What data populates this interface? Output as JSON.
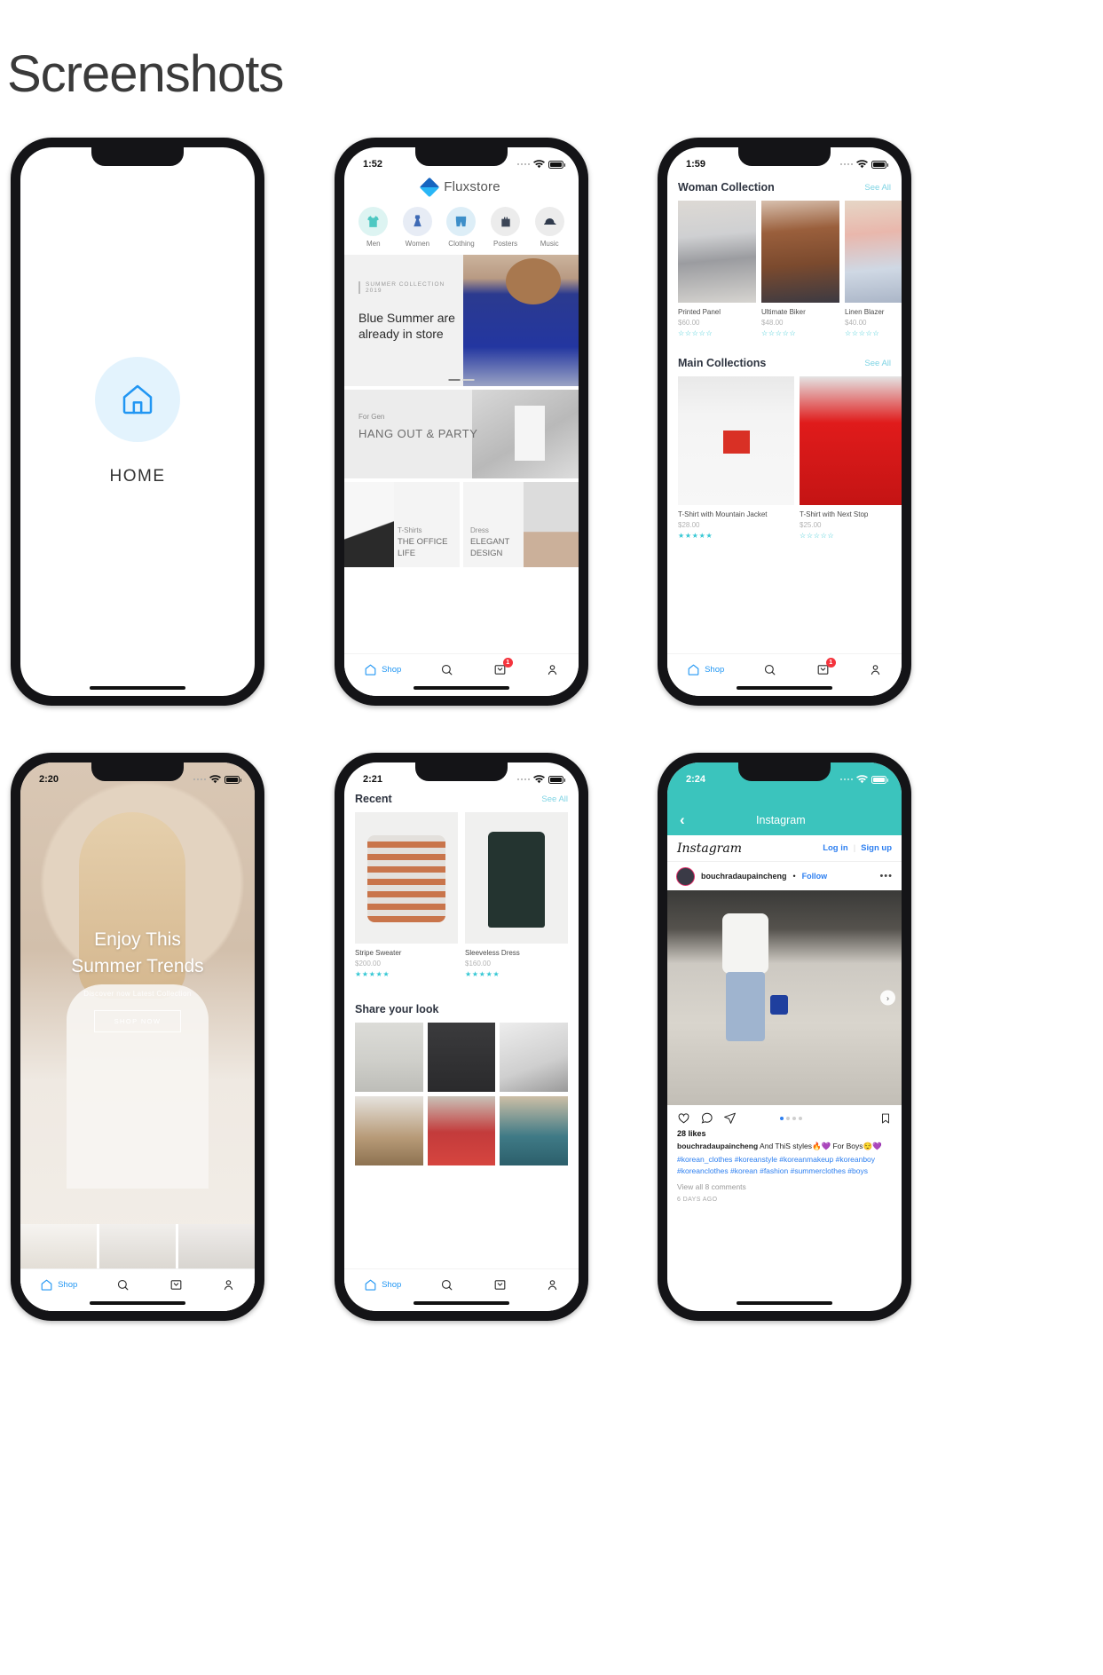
{
  "page": {
    "title": "Screenshots"
  },
  "phone1": {
    "splash": {
      "icon": "home-icon",
      "label": "HOME"
    }
  },
  "phone2": {
    "status": {
      "time": "1:52",
      "wifi": "wifi-icon",
      "battery": "battery-icon"
    },
    "brand": "Fluxstore",
    "categories": [
      {
        "label": "Men",
        "icon": "tshirt-icon",
        "bg": "#ddf4f2",
        "glyph": "👕"
      },
      {
        "label": "Women",
        "icon": "dress-icon",
        "bg": "#e7ecf5",
        "glyph": "👗"
      },
      {
        "label": "Clothing",
        "icon": "shorts-icon",
        "bg": "#ddeef7",
        "glyph": "🩳"
      },
      {
        "label": "Posters",
        "icon": "bag-icon",
        "bg": "#ebebeb",
        "glyph": "💼"
      },
      {
        "label": "Music",
        "icon": "hat-icon",
        "bg": "#ececec",
        "glyph": "🧢"
      }
    ],
    "banner": {
      "kicker": "SUMMER COLLECTION 2019",
      "headline": "Blue Summer are already in store"
    },
    "banner2": {
      "kicker": "For Gen",
      "headline": "HANG OUT & PARTY"
    },
    "tiles": [
      {
        "kicker": "T-Shirts",
        "headline": "THE OFFICE LIFE"
      },
      {
        "kicker": "Dress",
        "headline": "ELEGANT DESIGN"
      }
    ],
    "nav": [
      {
        "label": "Shop",
        "icon": "home-icon",
        "active": true
      },
      {
        "label": "",
        "icon": "search-icon",
        "active": false
      },
      {
        "label": "",
        "icon": "cart-icon",
        "active": false,
        "badge": "1"
      },
      {
        "label": "",
        "icon": "person-icon",
        "active": false
      }
    ]
  },
  "phone3": {
    "status": {
      "time": "1:59"
    },
    "sections": [
      {
        "title": "Woman Collection",
        "see_all": "See All",
        "products": [
          {
            "name": "Printed Panel",
            "price": "$60.00",
            "rating": 0
          },
          {
            "name": "Ultimate Biker",
            "price": "$48.00",
            "rating": 0
          },
          {
            "name": "Linen Blazer",
            "price": "$40.00",
            "rating": 0
          }
        ]
      },
      {
        "title": "Main Collections",
        "see_all": "See All",
        "products": [
          {
            "name": "T-Shirt with Mountain Jacket",
            "price": "$28.00",
            "rating": 5
          },
          {
            "name": "T-Shirt with Next Stop",
            "price": "$25.00",
            "rating": 0
          }
        ]
      }
    ],
    "nav": [
      {
        "label": "Shop",
        "icon": "home-icon",
        "active": true
      },
      {
        "label": "",
        "icon": "search-icon",
        "active": false
      },
      {
        "label": "",
        "icon": "cart-icon",
        "active": false,
        "badge": "1"
      },
      {
        "label": "",
        "icon": "person-icon",
        "active": false
      }
    ]
  },
  "phone4": {
    "status": {
      "time": "2:20"
    },
    "hero": {
      "line1": "Enjoy This",
      "line2": "Summer Trends",
      "subtitle": "Discover now Latest Collection",
      "button": "SHOP NOW"
    },
    "nav": [
      {
        "label": "Shop",
        "icon": "home-icon",
        "active": true
      },
      {
        "label": "",
        "icon": "search-icon",
        "active": false
      },
      {
        "label": "",
        "icon": "cart-icon",
        "active": false
      },
      {
        "label": "",
        "icon": "person-icon",
        "active": false
      }
    ]
  },
  "phone5": {
    "status": {
      "time": "2:21"
    },
    "section": {
      "title": "Recent",
      "see_all": "See All"
    },
    "products": [
      {
        "name": "Stripe Sweater",
        "price": "$200.00",
        "rating": 5
      },
      {
        "name": "Sleeveless Dress",
        "price": "$160.00",
        "rating": 5
      }
    ],
    "share": {
      "title": "Share your look"
    },
    "nav": [
      {
        "label": "Shop",
        "icon": "home-icon",
        "active": true
      },
      {
        "label": "",
        "icon": "search-icon",
        "active": false
      },
      {
        "label": "",
        "icon": "cart-icon",
        "active": false
      },
      {
        "label": "",
        "icon": "person-icon",
        "active": false
      }
    ]
  },
  "phone6": {
    "status": {
      "time": "2:24"
    },
    "navbar": {
      "back": "back-icon",
      "title": "Instagram"
    },
    "header": {
      "wordmark": "Instagram",
      "login": "Log in",
      "separator": "|",
      "signup": "Sign up"
    },
    "post": {
      "username": "bouchradaupaincheng",
      "dot": "•",
      "follow": "Follow",
      "more": "•••",
      "likes": "28 likes",
      "caption_user": "bouchradaupaincheng",
      "caption_text": " And ThiS styles🔥💜 For Boys😌💜",
      "hashtags": "#korean_clothes #koreanstyle #koreanmakeup #koreanboy #koreanclothes #korean #fashion #summerclothes #boys",
      "comments": "View all 8 comments",
      "time": "6 DAYS AGO"
    },
    "accent": "#3bc4bd"
  }
}
